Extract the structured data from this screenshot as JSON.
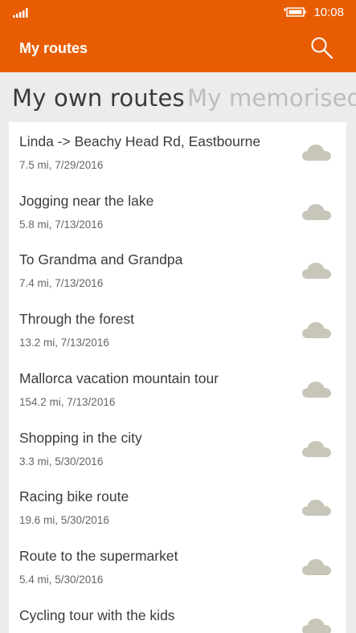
{
  "status": {
    "time": "10:08"
  },
  "header": {
    "title": "My routes"
  },
  "tabs": [
    {
      "label": "My own routes",
      "active": true
    },
    {
      "label": "My memorised routes",
      "active": false
    }
  ],
  "routes": [
    {
      "name": "Linda -> Beachy Head Rd, Eastbourne",
      "meta": "7.5 mi, 7/29/2016",
      "icon": "cloud-icon"
    },
    {
      "name": "Jogging near the lake",
      "meta": "5.8 mi, 7/13/2016",
      "icon": "cloud-icon"
    },
    {
      "name": "To Grandma and Grandpa",
      "meta": "7.4 mi, 7/13/2016",
      "icon": "cloud-icon"
    },
    {
      "name": "Through the forest",
      "meta": "13.2 mi, 7/13/2016",
      "icon": "cloud-icon"
    },
    {
      "name": "Mallorca vacation mountain tour",
      "meta": "154.2 mi, 7/13/2016",
      "icon": "cloud-icon"
    },
    {
      "name": "Shopping in the city",
      "meta": "3.3 mi, 5/30/2016",
      "icon": "cloud-icon"
    },
    {
      "name": "Racing bike route",
      "meta": "19.6 mi, 5/30/2016",
      "icon": "cloud-icon"
    },
    {
      "name": "Route to the supermarket",
      "meta": "5.4 mi, 5/30/2016",
      "icon": "cloud-icon"
    },
    {
      "name": "Cycling tour with the kids",
      "meta": "",
      "icon": "cloud-icon"
    }
  ],
  "colors": {
    "accent": "#e85d04",
    "cloud": "#c7c6b8"
  }
}
